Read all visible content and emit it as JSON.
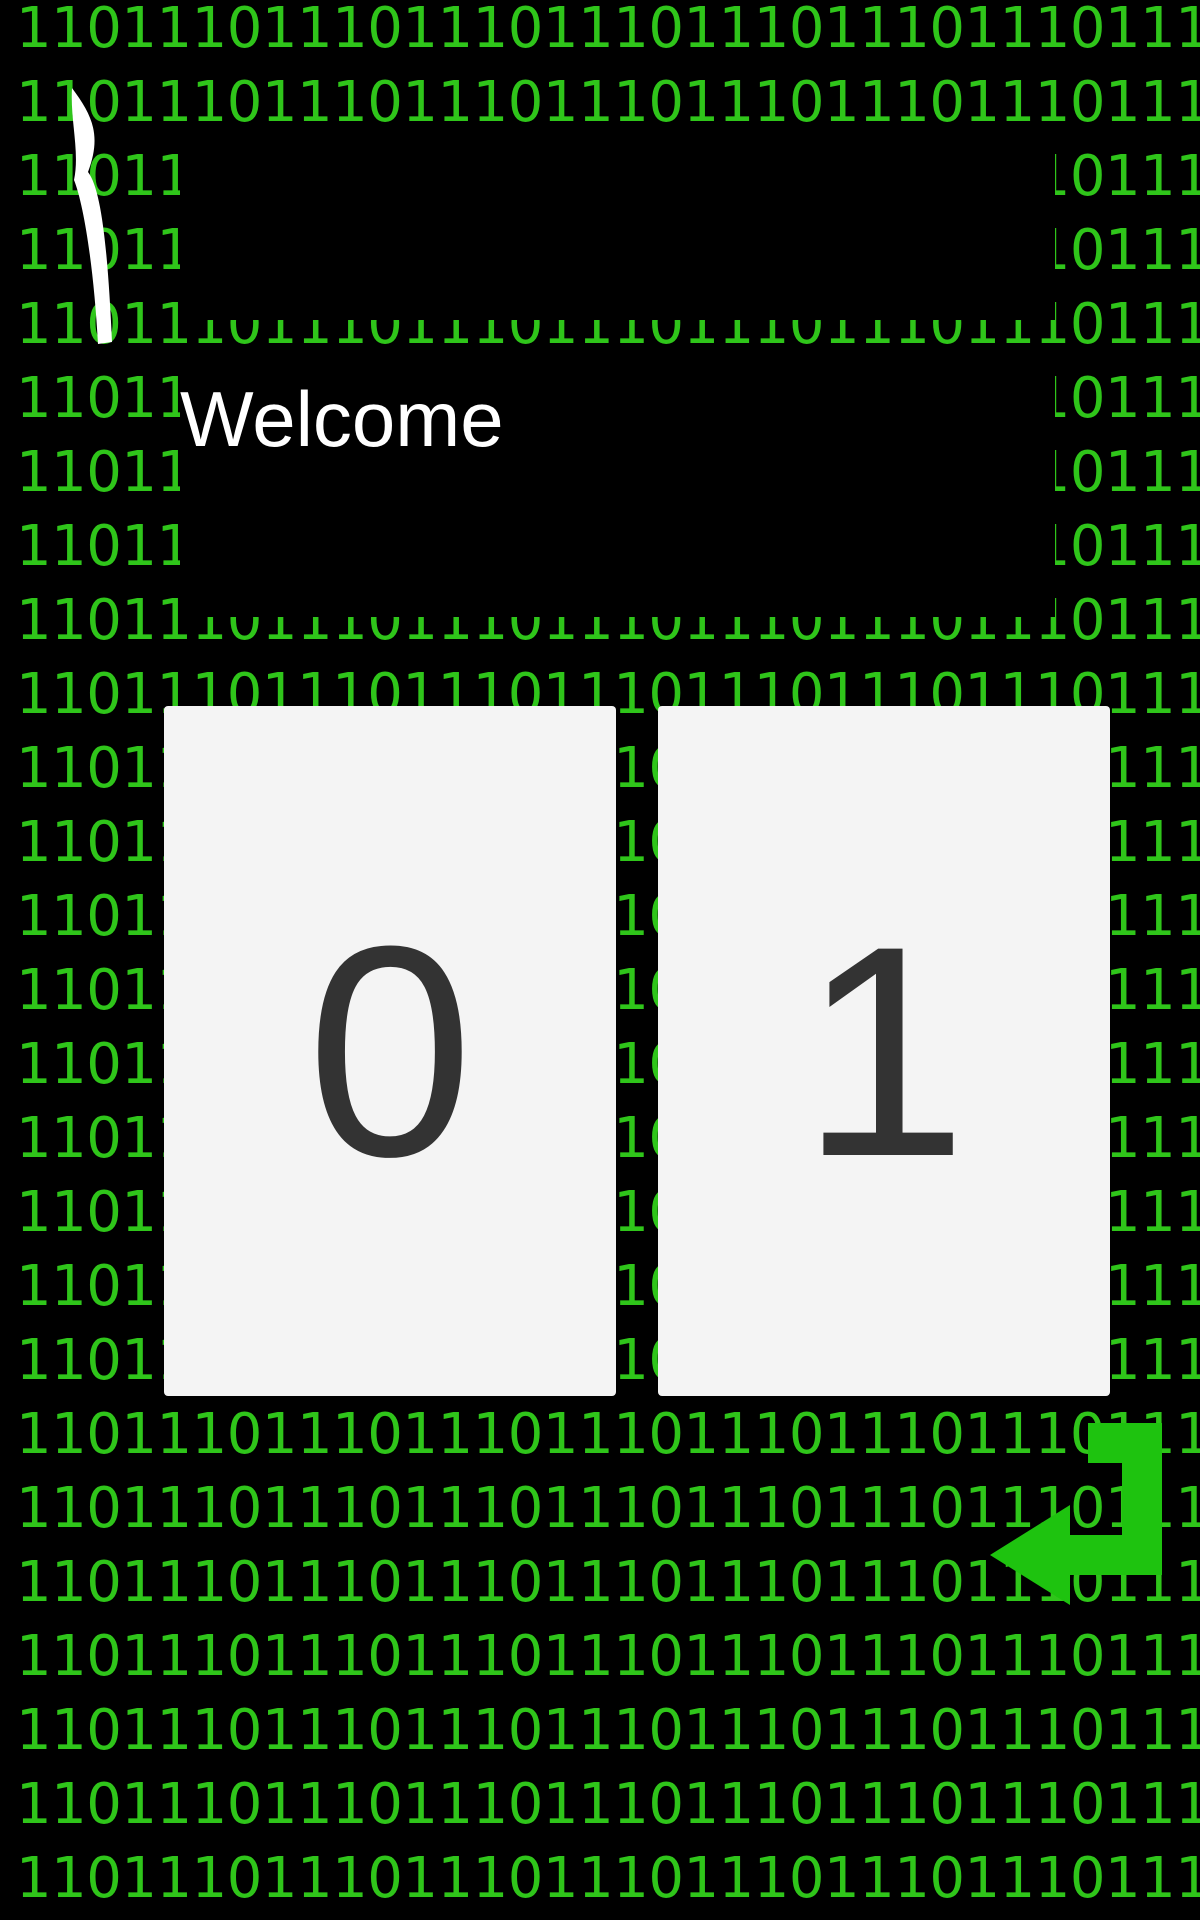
{
  "background": {
    "pattern_text": "1101",
    "repeat": 10,
    "row_count": 26,
    "color": "#2fc51a"
  },
  "welcome": {
    "title": "Welcome"
  },
  "keypad": {
    "zero_label": "0",
    "one_label": "1"
  },
  "icons": {
    "back": "swipe-back-icon",
    "enter": "enter-return-icon"
  },
  "colors": {
    "accent": "#2fc51a",
    "card": "#f4f4f4",
    "digit": "#333333",
    "text": "#ffffff",
    "background": "#000000"
  }
}
